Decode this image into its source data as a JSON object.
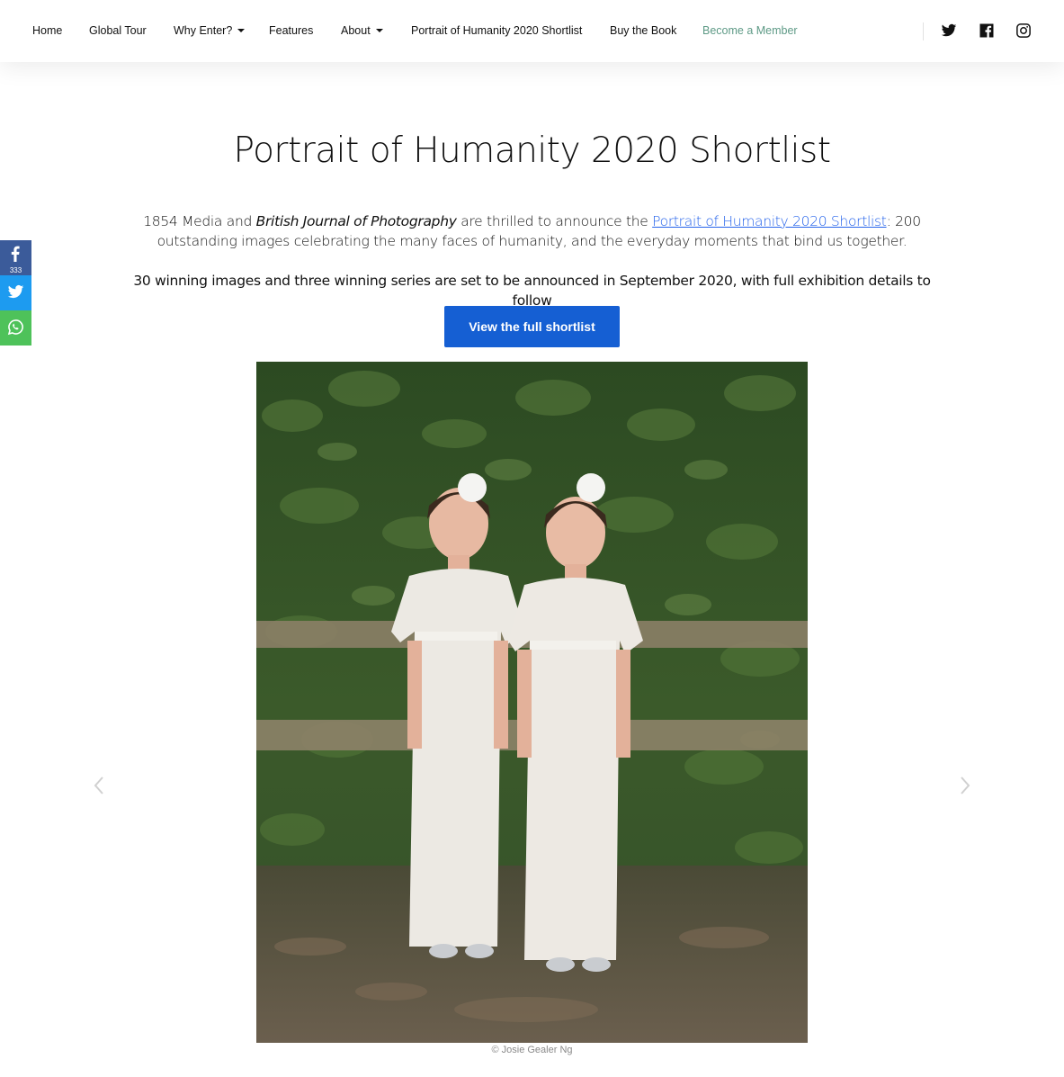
{
  "nav": {
    "items": [
      {
        "label": "Home"
      },
      {
        "label": "Global Tour"
      },
      {
        "label": "Why Enter?"
      },
      {
        "label": "Features"
      },
      {
        "label": "About"
      },
      {
        "label": "Portrait of Humanity 2020 Shortlist"
      },
      {
        "label": "Buy the Book"
      },
      {
        "label": "Become a Member"
      }
    ],
    "accent_color": "#5e9a86",
    "social": [
      "twitter-icon",
      "facebook-icon",
      "instagram-icon"
    ]
  },
  "share": {
    "facebook_count": "333",
    "colors": {
      "facebook": "#3b5b9a",
      "twitter": "#1d9bf0",
      "whatsapp": "#4ec25a"
    }
  },
  "main": {
    "title": "Portrait of Humanity 2020 Shortlist",
    "intro_part1": "1854 Media and ",
    "intro_em": "British Journal of Photography",
    "intro_part2": " are thrilled to announce the ",
    "intro_link": "Portrait of Humanity 2020 Shortlist",
    "intro_part3": ": 200 outstanding images celebrating the many faces of humanity, and the everyday moments that bind us together.",
    "subtext": "30 winning images and three winning series are set to be announced in September 2020, with full exhibition details to follow",
    "cta_label": "View the full shortlist",
    "cta_color": "#155fd3",
    "photo_credit": "© Josie Gealer Ng"
  }
}
